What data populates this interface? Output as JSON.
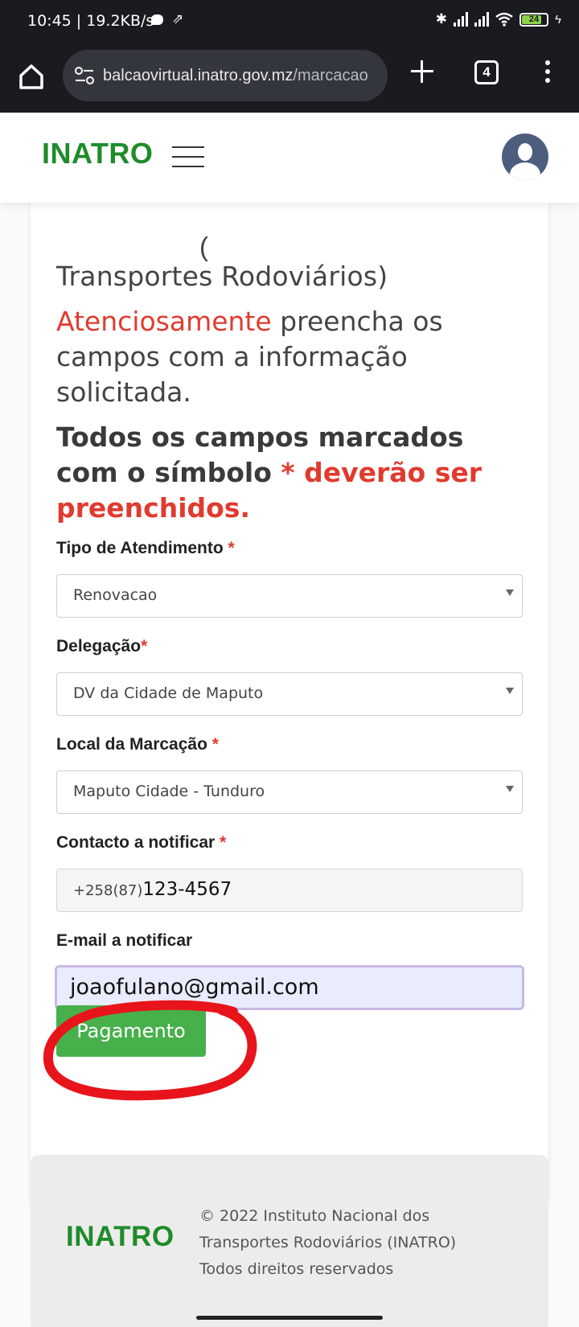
{
  "status_bar": {
    "time": "10:45 | 19.2KB/s",
    "battery": "24",
    "icons": [
      "chat-icon",
      "navigation-icon",
      "bluetooth-icon",
      "signal-icon",
      "signal-icon",
      "wifi-icon",
      "battery-icon",
      "charging-icon"
    ]
  },
  "browser": {
    "url_domain": "balcaovirtual.inatro.gov.mz",
    "url_path": "/marcacao",
    "tab_count": "4"
  },
  "header": {
    "logo": "INATRO"
  },
  "intro": {
    "cut_text": "(",
    "title": "Transportes Rodoviários)",
    "note_accent": "Atenciosamente",
    "note_rest": " preencha os campos com a informação solicitada.",
    "req_start": "Todos os campos marcados com o símbolo ",
    "req_accent": "* deverão ser preenchidos."
  },
  "form": {
    "required_marker": "*",
    "tipo": {
      "label": "Tipo de Atendimento ",
      "value": "Renovacao"
    },
    "delegacao": {
      "label": "Delegação",
      "value": "DV da Cidade de Maputo"
    },
    "local": {
      "label": "Local da Marcação ",
      "value": "Maputo Cidade - Tunduro"
    },
    "contacto": {
      "label": "Contacto a notificar ",
      "prefix": "+258(87)",
      "value": "123-4567"
    },
    "email": {
      "label": "E-mail a notificar",
      "value": "joaofulano@gmail.com"
    },
    "submit_label": "Pagamento"
  },
  "annotation": {
    "color": "#e8141b"
  },
  "footer": {
    "logo": "INATRO",
    "copyright_line1": "© 2022 Instituto Nacional dos",
    "copyright_line2": "Transportes Rodoviários (INATRO)",
    "copyright_line3": "Todos direitos reservados"
  },
  "colors": {
    "brand_green": "#1f8c2a",
    "accent_red": "#e03b2e",
    "button_green": "#47b04b"
  }
}
